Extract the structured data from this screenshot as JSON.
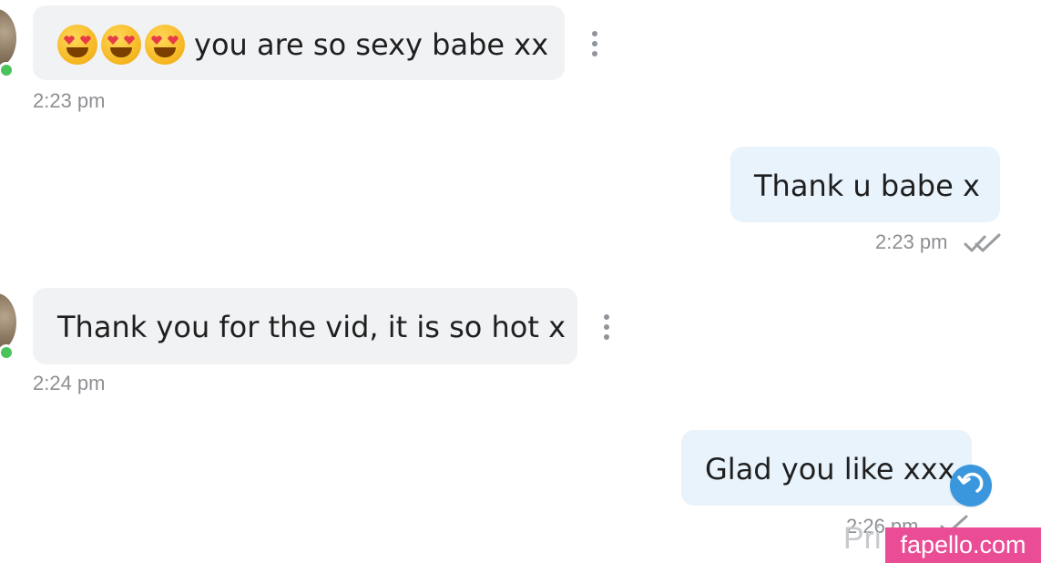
{
  "messages": [
    {
      "direction": "incoming",
      "text": "you are so sexy babe xx",
      "time": "2:23 pm",
      "emoji_prefix": [
        "heart-eyes-emoji",
        "heart-eyes-emoji",
        "heart-eyes-emoji"
      ]
    },
    {
      "direction": "outgoing",
      "text": "Thank u babe x",
      "time": "2:23 pm",
      "status_icon": "double-check-icon"
    },
    {
      "direction": "incoming",
      "text": "Thank you for the vid, it is so hot x",
      "time": "2:24 pm"
    },
    {
      "direction": "outgoing",
      "text": "Glad you like xxx",
      "time": "2:26 pm",
      "status_icon": "check-icon"
    }
  ],
  "ui": {
    "reply_icon": "reply-icon",
    "message_menu_icon": "more-vertical-icon"
  },
  "overlays": {
    "partial_text": "Pri",
    "brand_badge": "fapello.com"
  },
  "colors": {
    "incoming_bubble": "#f1f2f4",
    "outgoing_bubble": "#e8f3fb",
    "online_status": "#4ac45a",
    "reply_button": "#3b97dd",
    "brand_badge": "#ea4d95",
    "timestamp_text": "#8d8f92"
  }
}
